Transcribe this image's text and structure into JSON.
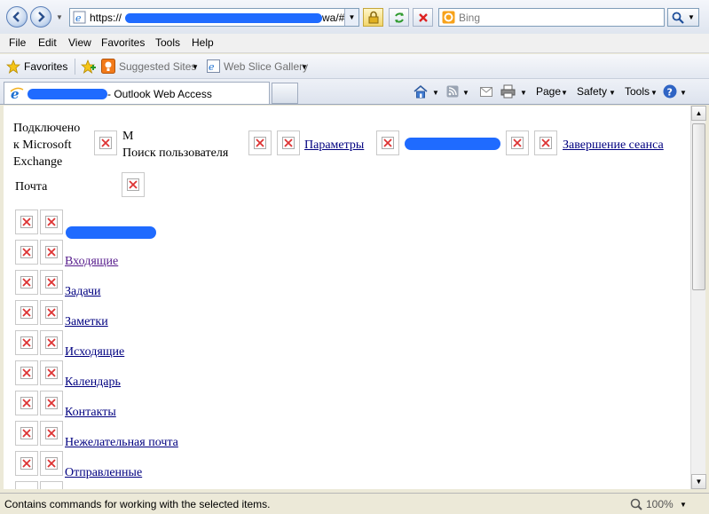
{
  "browser": {
    "address": "https://",
    "address_tail": "wa/#",
    "search_placeholder": "Bing",
    "tab_title": "- Outlook Web Access"
  },
  "menu": [
    "File",
    "Edit",
    "View",
    "Favorites",
    "Tools",
    "Help"
  ],
  "favorites_bar": {
    "favorites_label": "Favorites",
    "suggested_sites": "Suggested Sites",
    "web_slice_gallery": "Web Slice Gallery"
  },
  "commands": {
    "page": "Page",
    "safety": "Safety",
    "tools": "Tools"
  },
  "owa": {
    "connected_line1": "Подключено",
    "connected_line2": "к Microsoft",
    "connected_line3": "Exchange",
    "mailbox_letter": "М",
    "find_user": "Поиск пользователя",
    "options": "Параметры",
    "logoff": "Завершение сеанса",
    "mail_label": "Почта",
    "folders": [
      "Входящие",
      "Задачи",
      "Заметки",
      "Исходящие",
      "Календарь",
      "Контакты",
      "Нежелательная почта",
      "Отправленные"
    ]
  },
  "status": {
    "text": "Contains commands for working with the selected items.",
    "zoom": "100%"
  },
  "colors": {
    "link": "#000080",
    "visited_link": "#551a8b",
    "redaction": "#1f6bff"
  }
}
